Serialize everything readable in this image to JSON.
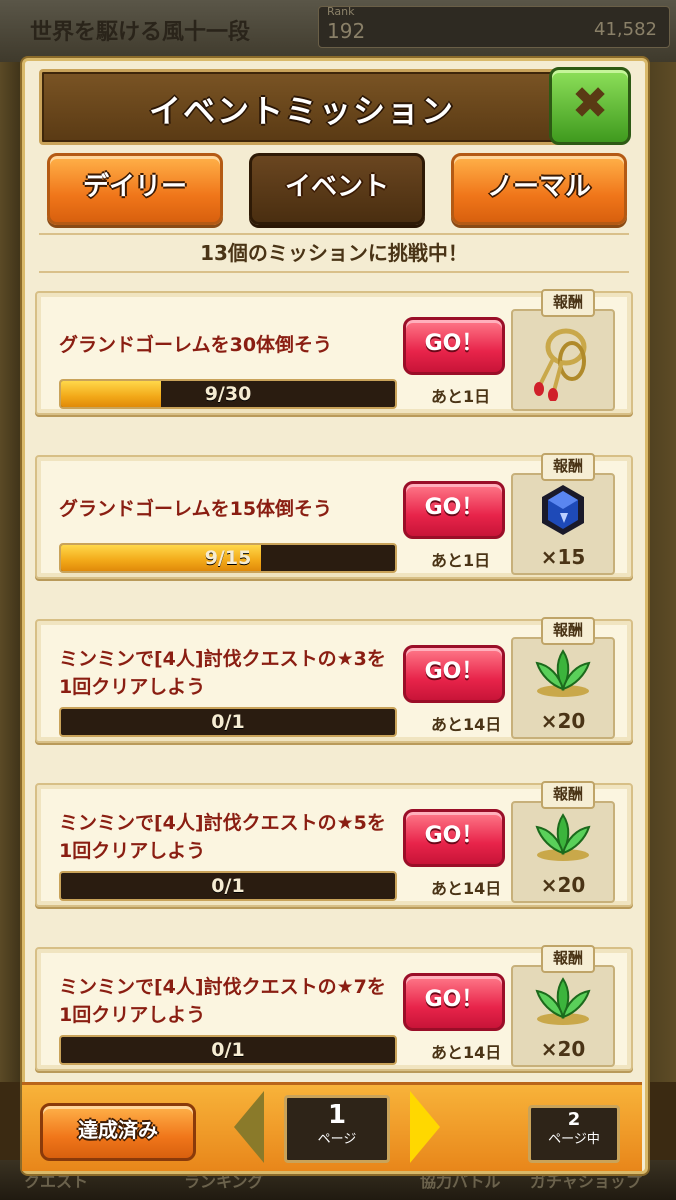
{
  "background": {
    "title": "世界を駆ける風十一段",
    "rank_label": "Rank",
    "rank_value": "192",
    "coins": "41,582",
    "bottom_labels": [
      "クエスト",
      "ランキング",
      "協力バトル",
      "ガチャショップ"
    ]
  },
  "header": {
    "title": "イベントミッション",
    "close_label": "✖"
  },
  "tabs": [
    {
      "label": "デイリー",
      "active": false
    },
    {
      "label": "イベント",
      "active": true
    },
    {
      "label": "ノーマル",
      "active": false
    }
  ],
  "banner": "13個のミッションに挑戦中！",
  "reward_label": "報酬",
  "go_label": "GO！",
  "missions": [
    {
      "text": "グランドゴーレムを30体倒そう",
      "progress": "9/30",
      "fraction": 0.3,
      "deadline": "あと1日",
      "reward_icon": "golden-rope-icon",
      "reward_qty": ""
    },
    {
      "text": "グランドゴーレムを15体倒そう",
      "progress": "9/15",
      "fraction": 0.6,
      "deadline": "あと1日",
      "reward_icon": "blue-crystal-icon",
      "reward_qty": "×15"
    },
    {
      "text": "ミンミンで[4人]討伐クエストの★3を1回クリアしよう",
      "progress": "0/1",
      "fraction": 0.0,
      "deadline": "あと14日",
      "reward_icon": "green-leaf-icon",
      "reward_qty": "×20"
    },
    {
      "text": "ミンミンで[4人]討伐クエストの★5を1回クリアしよう",
      "progress": "0/1",
      "fraction": 0.0,
      "deadline": "あと14日",
      "reward_icon": "green-leaf-icon",
      "reward_qty": "×20"
    },
    {
      "text": "ミンミンで[4人]討伐クエストの★7を1回クリアしよう",
      "progress": "0/1",
      "fraction": 0.0,
      "deadline": "あと14日",
      "reward_icon": "green-leaf-icon",
      "reward_qty": "×20"
    }
  ],
  "footer": {
    "completed_label": "達成済み",
    "current_page": "1",
    "page_unit": "ページ",
    "total_pages": "2",
    "total_unit": "ページ中"
  }
}
